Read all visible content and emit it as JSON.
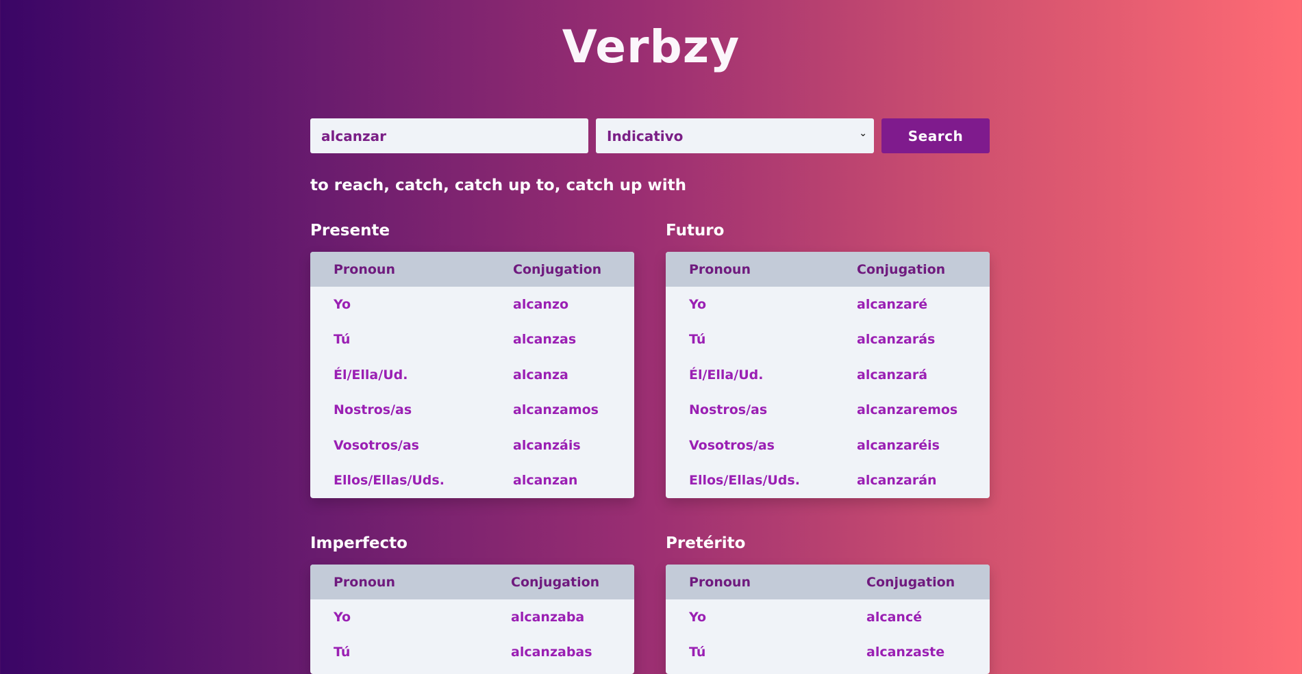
{
  "app": {
    "title": "Verbzy"
  },
  "search": {
    "verb_value": "alcanzar",
    "mood_selected": "Indicativo",
    "button_label": "Search"
  },
  "translation": "to reach, catch, catch up to, catch up with",
  "table_headers": {
    "pronoun": "Pronoun",
    "conjugation": "Conjugation"
  },
  "tenses": {
    "presente": {
      "title": "Presente",
      "rows": [
        {
          "pronoun": "Yo",
          "form": "alcanzo"
        },
        {
          "pronoun": "Tú",
          "form": "alcanzas"
        },
        {
          "pronoun": "Él/Ella/Ud.",
          "form": "alcanza"
        },
        {
          "pronoun": "Nostros/as",
          "form": "alcanzamos"
        },
        {
          "pronoun": "Vosotros/as",
          "form": "alcanzáis"
        },
        {
          "pronoun": "Ellos/Ellas/Uds.",
          "form": "alcanzan"
        }
      ]
    },
    "futuro": {
      "title": "Futuro",
      "rows": [
        {
          "pronoun": "Yo",
          "form": "alcanzaré"
        },
        {
          "pronoun": "Tú",
          "form": "alcanzarás"
        },
        {
          "pronoun": "Él/Ella/Ud.",
          "form": "alcanzará"
        },
        {
          "pronoun": "Nostros/as",
          "form": "alcanzaremos"
        },
        {
          "pronoun": "Vosotros/as",
          "form": "alcanzaréis"
        },
        {
          "pronoun": "Ellos/Ellas/Uds.",
          "form": "alcanzarán"
        }
      ]
    },
    "imperfecto": {
      "title": "Imperfecto",
      "rows": [
        {
          "pronoun": "Yo",
          "form": "alcanzaba"
        },
        {
          "pronoun": "Tú",
          "form": "alcanzabas"
        }
      ]
    },
    "preterito": {
      "title": "Pretérito",
      "rows": [
        {
          "pronoun": "Yo",
          "form": "alcancé"
        },
        {
          "pronoun": "Tú",
          "form": "alcanzaste"
        }
      ]
    }
  }
}
